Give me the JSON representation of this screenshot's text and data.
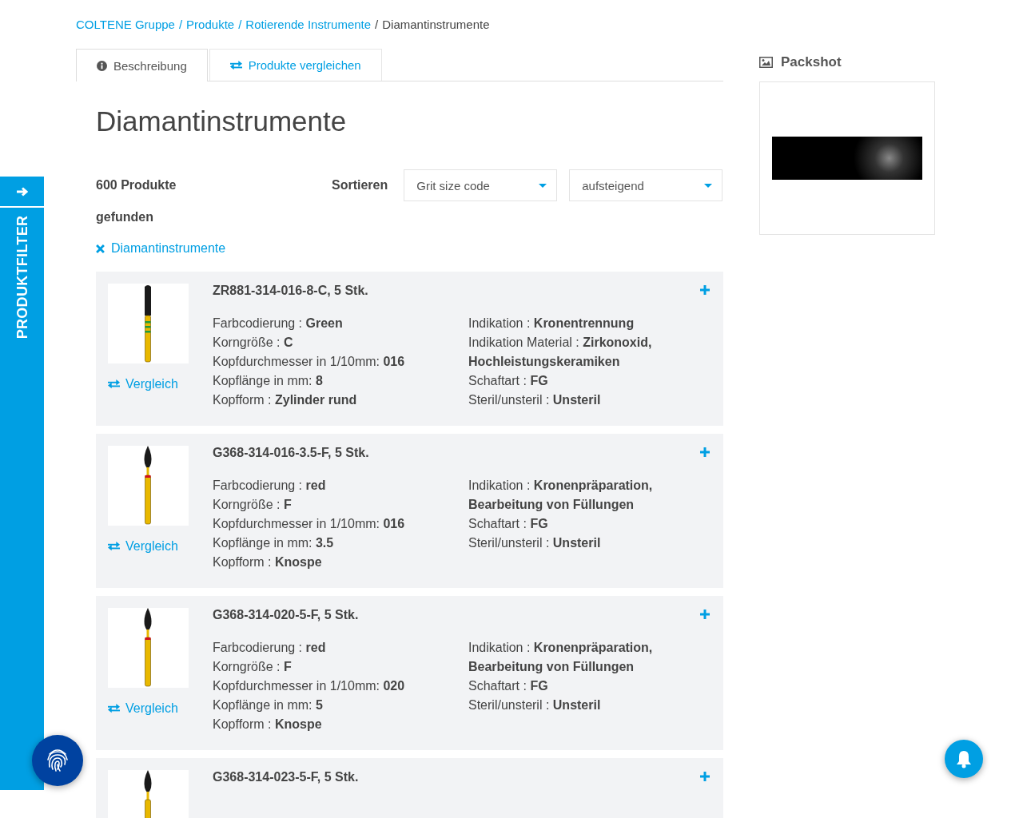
{
  "breadcrumb": [
    {
      "label": "COLTENE Gruppe",
      "link": true
    },
    {
      "separator": "/",
      "label": "Produkte",
      "link": true
    },
    {
      "separator": "/",
      "label": "Rotierende Instrumente",
      "link": true
    },
    {
      "separator": "/",
      "label": "Diamantinstrumente",
      "link": false
    }
  ],
  "tabs": [
    {
      "label": "Beschreibung",
      "selected": true
    },
    {
      "label": "Produkte vergleichen",
      "selected": false
    }
  ],
  "title": "Diamantinstrumente",
  "result_count": "600 Produkte gefunden",
  "sort": {
    "label": "Sortieren",
    "field": "Grit size code",
    "order": "aufsteigend"
  },
  "active_filter": "Diamantinstrumente",
  "products": [
    {
      "name": "ZR881-314-016-8-C, 5 Stk.",
      "kind": "cylinder",
      "color": "#1f9a3c",
      "compare": "Vergleich",
      "left": [
        "Farbcodierung : **Green**",
        "Korngröße : **C**",
        "Kopfdurchmesser in 1/10mm: **016**",
        "Kopflänge in mm: **8**",
        "Kopfform : **Zylinder rund**"
      ],
      "right": [
        "Indikation : **Kronentrennung**",
        "Indikation Material : **Zirkonoxid, Hochleistungskeramiken**",
        "Schaftart : **FG**",
        "Steril/unsteril : **Unsteril**"
      ]
    },
    {
      "name": "G368-314-016-3.5-F, 5 Stk.",
      "kind": "bud",
      "color": "#d0101e",
      "compare": "Vergleich",
      "left": [
        "Farbcodierung : **red**",
        "Korngröße : **F**",
        "Kopfdurchmesser in 1/10mm: **016**",
        "Kopflänge in mm: **3.5**",
        "Kopfform : **Knospe**"
      ],
      "right": [
        "Indikation : **Kronenpräparation, Bearbeitung von Füllungen**",
        "Schaftart : **FG**",
        "Steril/unsteril : **Unsteril**"
      ]
    },
    {
      "name": "G368-314-020-5-F, 5 Stk.",
      "kind": "bud",
      "color": "#d0101e",
      "compare": "Vergleich",
      "left": [
        "Farbcodierung : **red**",
        "Korngröße : **F**",
        "Kopfdurchmesser in 1/10mm: **020**",
        "Kopflänge in mm: **5**",
        "Kopfform : **Knospe**"
      ],
      "right": [
        "Indikation : **Kronenpräparation, Bearbeitung von Füllungen**",
        "Schaftart : **FG**",
        "Steril/unsteril : **Unsteril**"
      ]
    },
    {
      "name": "G368-314-023-5-F, 5 Stk.",
      "kind": "bud"
    }
  ],
  "side_filter": {
    "label": "PRODUKTFILTER"
  },
  "packshot": {
    "title": "Packshot"
  }
}
